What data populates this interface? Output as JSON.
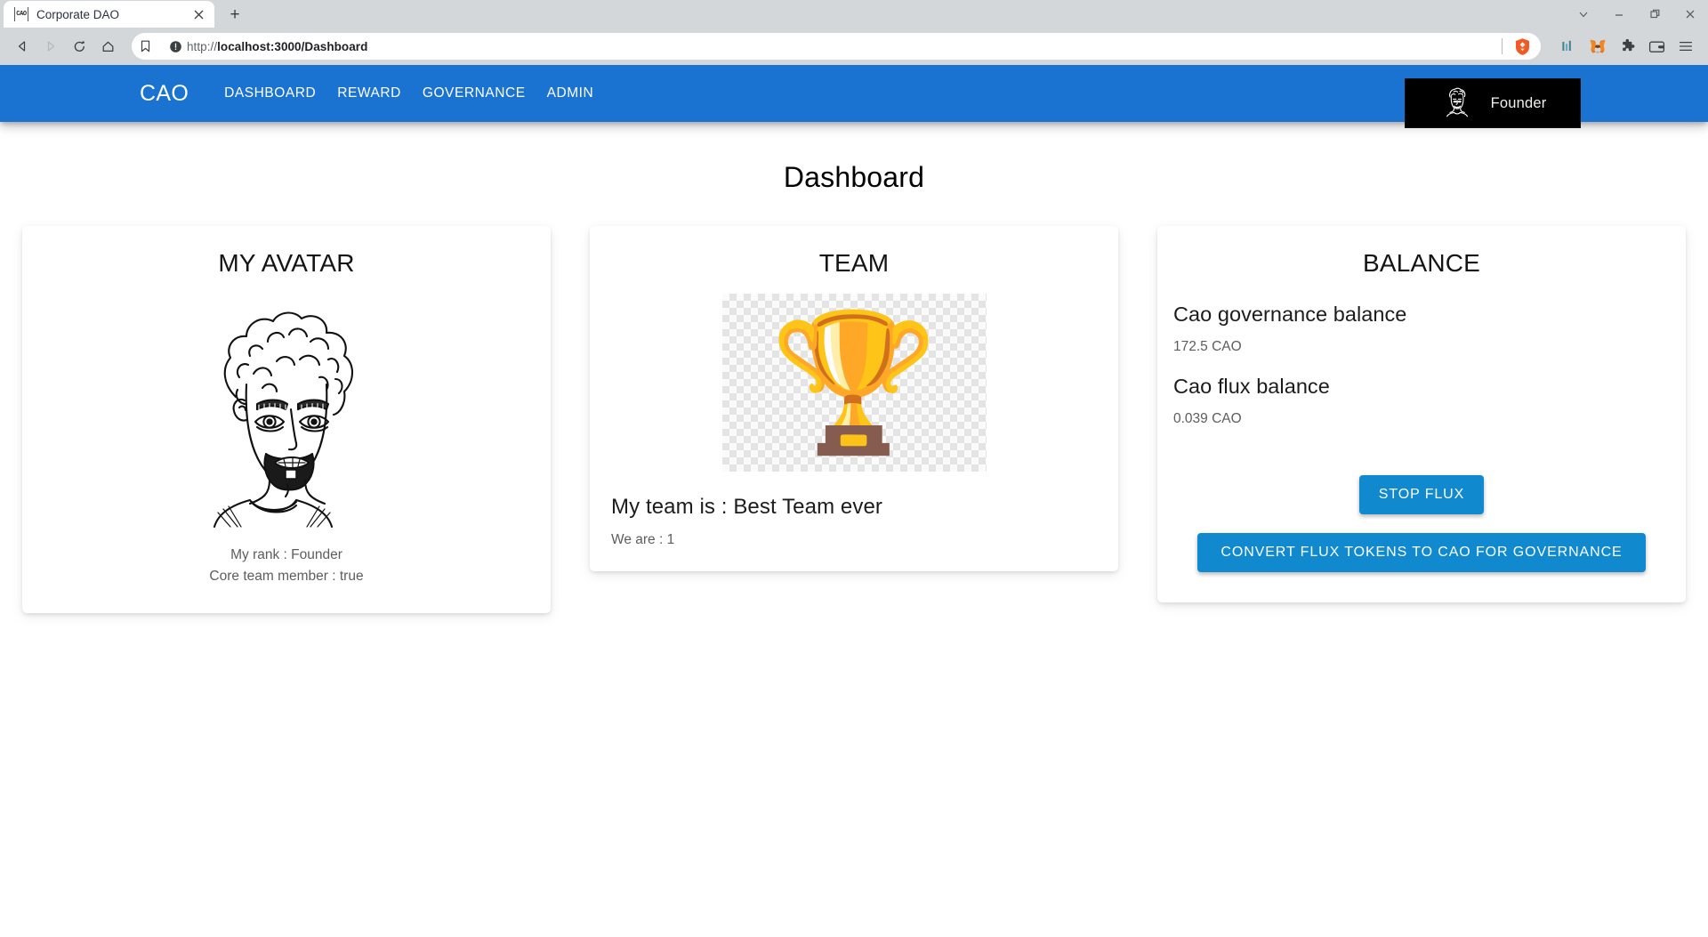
{
  "browser": {
    "tab": {
      "favicon_label": "CAO",
      "title": "Corporate DAO",
      "close_icon": "close-icon"
    },
    "new_tab_label": "+",
    "window_controls": {
      "list_label": "⌄",
      "minimize_label": "—",
      "restore_label": "❐",
      "close_label": "✕"
    },
    "toolbar": {
      "back_label": "◁",
      "forward_label": "▷",
      "reload_label": "⟳",
      "home_label": "⌂",
      "url_scheme": "http://",
      "url_rest": "localhost:3000/Dashboard",
      "url_full": "http://localhost:3000/Dashboard"
    }
  },
  "appbar": {
    "brand": "CAO",
    "links": [
      {
        "label": "DASHBOARD"
      },
      {
        "label": "REWARD"
      },
      {
        "label": "GOVERNANCE"
      },
      {
        "label": "ADMIN"
      }
    ],
    "account": {
      "label": "Founder"
    }
  },
  "page": {
    "title": "Dashboard"
  },
  "cards": {
    "avatar": {
      "title": "MY AVATAR",
      "rank_line": "My rank : Founder",
      "core_member_line": "Core team member : true"
    },
    "team": {
      "title": "TEAM",
      "trophy_glyph": "🏆",
      "headline": "My team is : Best Team ever",
      "count_line": "We are : 1"
    },
    "balance": {
      "title": "BALANCE",
      "governance_label": "Cao governance balance",
      "governance_value": "172.5 CAO",
      "flux_label": "Cao flux balance",
      "flux_value": "0.039 CAO",
      "stop_flux_button": "STOP FLUX",
      "convert_button": "CONVERT FLUX TOKENS TO CAO FOR GOVERNANCE"
    }
  },
  "colors": {
    "appbar_blue": "#1a73d1",
    "button_blue": "#1089ce",
    "badge_black": "#000000",
    "page_bg": "#ffffff"
  }
}
